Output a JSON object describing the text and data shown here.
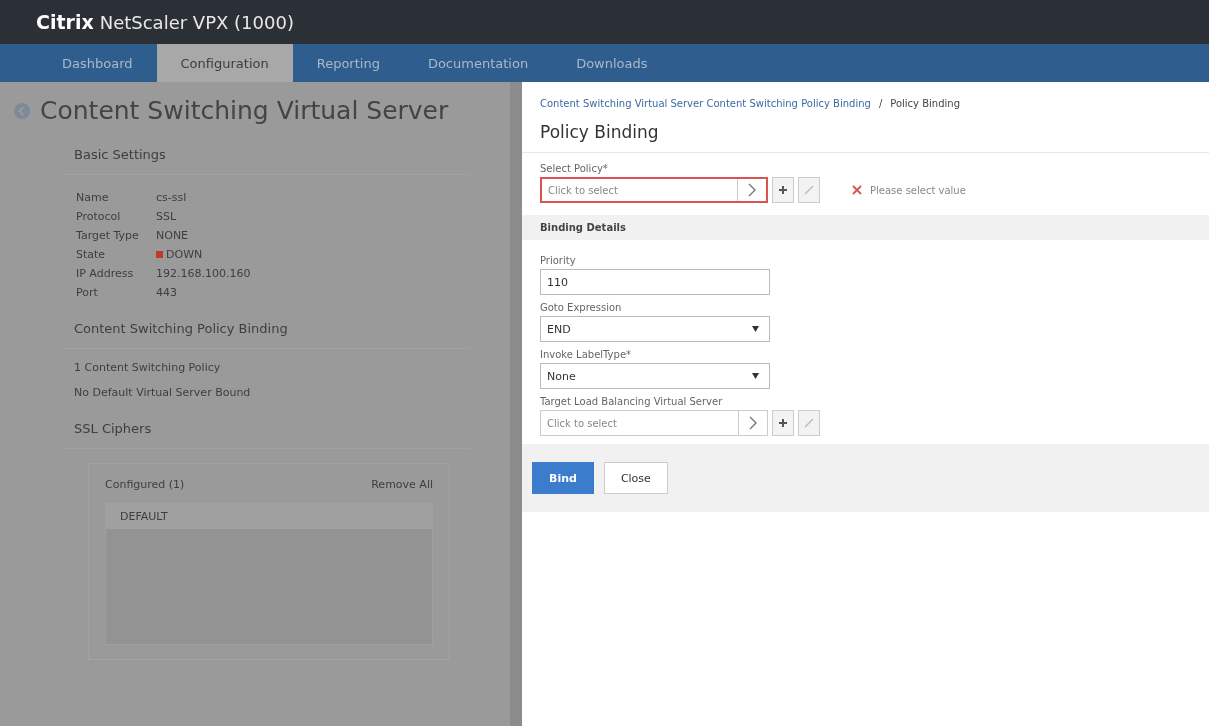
{
  "header": {
    "brand": "Citrix",
    "product": "NetScaler VPX (1000)"
  },
  "nav": [
    {
      "label": "Dashboard",
      "selected": false
    },
    {
      "label": "Configuration",
      "selected": true
    },
    {
      "label": "Reporting",
      "selected": false
    },
    {
      "label": "Documentation",
      "selected": false
    },
    {
      "label": "Downloads",
      "selected": false
    }
  ],
  "background_page": {
    "title": "Content Switching Virtual Server",
    "basic_settings": {
      "heading": "Basic Settings",
      "rows": [
        {
          "label": "Name",
          "value": "cs-ssl"
        },
        {
          "label": "Protocol",
          "value": "SSL"
        },
        {
          "label": "Target Type",
          "value": "NONE"
        },
        {
          "label": "State",
          "value": "DOWN",
          "color": "#c0392b"
        },
        {
          "label": "IP Address",
          "value": "192.168.100.160"
        },
        {
          "label": "Port",
          "value": "443"
        }
      ]
    },
    "policy_binding": {
      "heading": "Content Switching Policy Binding",
      "items": [
        "1 Content Switching Policy",
        "No Default Virtual Server Bound"
      ]
    },
    "ssl_ciphers": {
      "heading": "SSL Ciphers",
      "configured": "Configured (1)",
      "remove_all": "Remove All",
      "items": [
        "DEFAULT"
      ]
    }
  },
  "dialog": {
    "breadcrumb": {
      "link": "Content Switching Virtual Server Content Switching Policy Binding",
      "separator": "/",
      "current": "Policy Binding"
    },
    "title": "Policy Binding",
    "policy_field": {
      "label": "Select Policy*",
      "placeholder": "Click to select",
      "error": "Please select value"
    },
    "section": "Binding Details",
    "fields": [
      {
        "kind": "text",
        "label": "Priority",
        "value": "110"
      },
      {
        "kind": "select",
        "label": "Goto Expression",
        "value": "END"
      },
      {
        "kind": "select",
        "label": "Invoke LabelType*",
        "value": "None"
      },
      {
        "kind": "picker",
        "label": "Target Load Balancing Virtual Server",
        "placeholder": "Click to select"
      }
    ],
    "buttons": [
      {
        "label": "Bind",
        "kind": "primary"
      },
      {
        "label": "Close",
        "kind": "secondary"
      }
    ]
  }
}
